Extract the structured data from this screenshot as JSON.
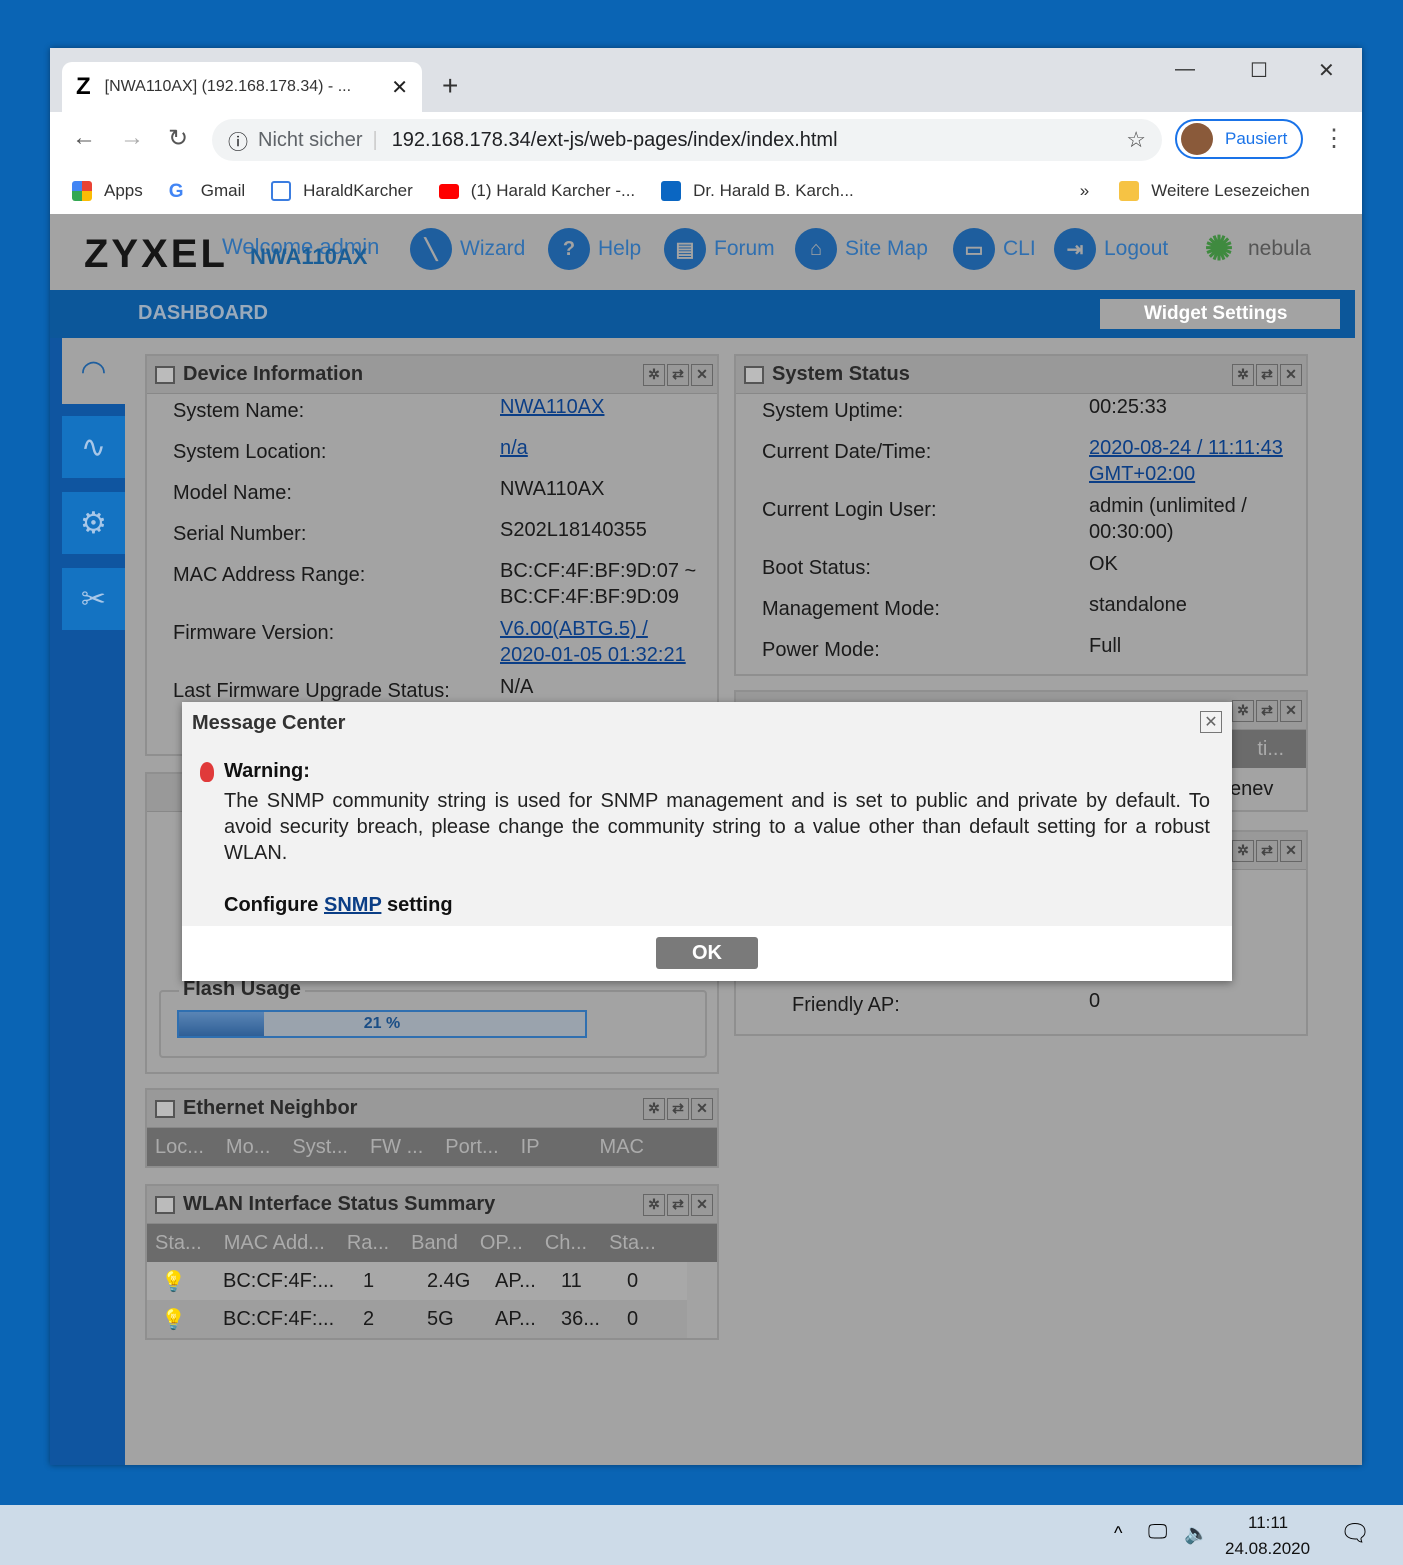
{
  "browser": {
    "tab_title": "[NWA110AX] (192.168.178.34) - ...",
    "tab_favicon": "Z",
    "not_secure": "Nicht sicher",
    "url": "192.168.178.34/ext-js/web-pages/index/index.html",
    "profile": "Pausiert",
    "bookmarks": [
      "Apps",
      "Gmail",
      "HaraldKarcher",
      "(1) Harald Karcher -...",
      "Dr. Harald B. Karch..."
    ],
    "more": "»",
    "other_bookmarks": "Weitere Lesezeichen"
  },
  "header": {
    "logo": "ZYXEL",
    "welcome": "Welcome admin",
    "device": "NWA110AX",
    "nav": [
      "Wizard",
      "Help",
      "Forum",
      "Site Map",
      "CLI",
      "Logout"
    ],
    "nebula": "nebula"
  },
  "dashboard": {
    "title": "DASHBOARD",
    "widget_settings": "Widget Settings"
  },
  "device_info": {
    "title": "Device Information",
    "rows": [
      {
        "label": "System Name:",
        "value": "NWA110AX"
      },
      {
        "label": "System Location:",
        "value": "n/a"
      },
      {
        "label": "Model Name:",
        "value": "NWA110AX"
      },
      {
        "label": "Serial Number:",
        "value": "S202L18140355"
      },
      {
        "label": "MAC Address Range:",
        "value": "BC:CF:4F:BF:9D:07 ~",
        "value2": "BC:CF:4F:BF:9D:09"
      },
      {
        "label": "Firmware Version:",
        "value": "V6.00(ABTG.5) /",
        "value2": "2020-01-05 01:32:21"
      },
      {
        "label": "Last Firmware Upgrade Status:",
        "value": "N/A"
      }
    ]
  },
  "system_status": {
    "title": "System Status",
    "rows": [
      {
        "label": "System Uptime:",
        "value": "00:25:33"
      },
      {
        "label": "Current Date/Time:",
        "value": "2020-08-24 / 11:11:43",
        "value2": "GMT+02:00"
      },
      {
        "label": "Current Login User:",
        "value": "admin (unlimited /",
        "value2": "00:30:00)"
      },
      {
        "label": "Boot Status:",
        "value": "OK"
      },
      {
        "label": "Management Mode:",
        "value": "standalone"
      },
      {
        "label": "Power Mode:",
        "value": "Full"
      }
    ]
  },
  "partial": {
    "col": "ti...",
    "val": "enev",
    "friendly_label": "Friendly AP:",
    "friendly_value": "0"
  },
  "flash": {
    "label": "Flash Usage",
    "percent": 21,
    "text": "21 %"
  },
  "ethernet": {
    "title": "Ethernet Neighbor",
    "columns": [
      "Loc...",
      "Mo...",
      "Syst...",
      "FW ...",
      "Port...",
      "IP",
      "MAC"
    ]
  },
  "wlan": {
    "title": "WLAN Interface Status Summary",
    "columns": [
      "Sta...",
      "MAC Add...",
      "Ra...",
      "Band",
      "OP...",
      "Ch...",
      "Sta..."
    ],
    "rows": [
      [
        "BC:CF:4F:...",
        "1",
        "2.4G",
        "AP...",
        "11",
        "0"
      ],
      [
        "BC:CF:4F:...",
        "2",
        "5G",
        "AP...",
        "36...",
        "0"
      ]
    ]
  },
  "dialog": {
    "title": "Message Center",
    "warning": "Warning:",
    "message": "The SNMP community string is used for SNMP management and is set to public and private by default. To avoid security breach, please change the community string to a value other than default setting for a robust WLAN.",
    "configure": "Configure",
    "link": "SNMP",
    "setting": "setting",
    "ok": "OK"
  },
  "taskbar": {
    "time": "11:11",
    "date": "24.08.2020"
  }
}
